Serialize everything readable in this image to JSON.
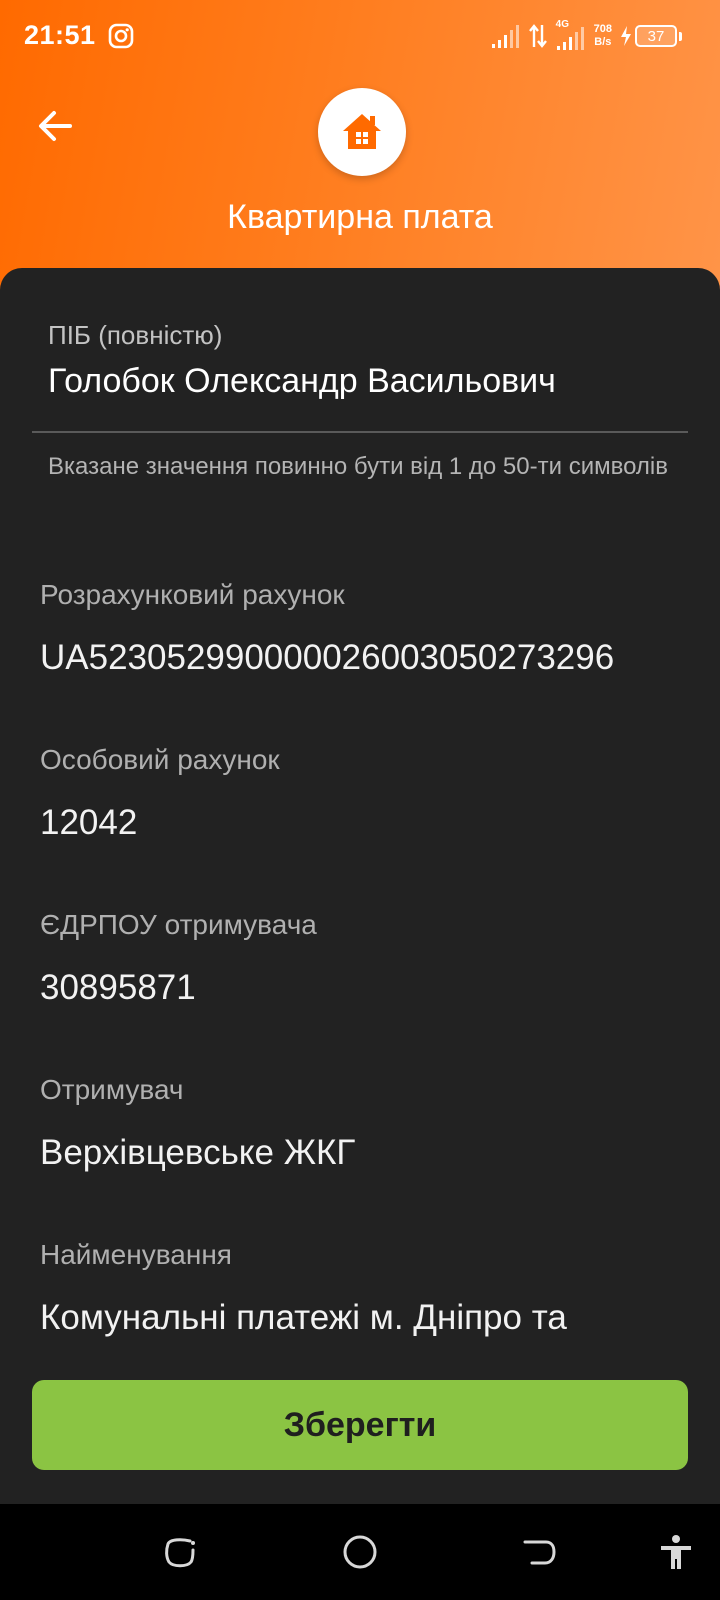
{
  "status_bar": {
    "time": "21:51",
    "network_type": "4G",
    "net_speed_value": "708",
    "net_speed_unit": "B/s",
    "battery_level": "37",
    "icons": [
      "instagram-icon",
      "signal-icon",
      "data-transfer-icon",
      "signal-4g-icon",
      "charging-icon",
      "battery-icon"
    ]
  },
  "header": {
    "title": "Квартирна плата",
    "back_icon": "arrow-left-icon",
    "category_icon": "home-icon"
  },
  "form": {
    "full_name": {
      "label": "ПІБ (повністю)",
      "value": "Голобок Олександр Васильович",
      "helper": "Вказане значення повинно бути від 1 до 50-ти символів"
    },
    "fields": [
      {
        "label": "Розрахунковий рахунок",
        "value": "UA523052990000026003050273296"
      },
      {
        "label": "Особовий рахунок",
        "value": "12042"
      },
      {
        "label": "ЄДРПОУ отримувача",
        "value": "30895871"
      },
      {
        "label": "Отримувач",
        "value": "Верхівцевське ЖКГ"
      },
      {
        "label": "Найменування",
        "value": "Комунальні платежі м. Дніпро та"
      }
    ]
  },
  "actions": {
    "save_label": "Зберегти"
  },
  "nav_bar": {
    "icons": [
      "recent-apps-icon",
      "home-circle-icon",
      "back-nav-icon",
      "accessibility-icon"
    ]
  },
  "colors": {
    "header_gradient_start": "#ff6a00",
    "header_gradient_end": "#ff9448",
    "sheet_background": "#222222",
    "save_button": "#8bc443",
    "accent_orange": "#ff6a00"
  }
}
